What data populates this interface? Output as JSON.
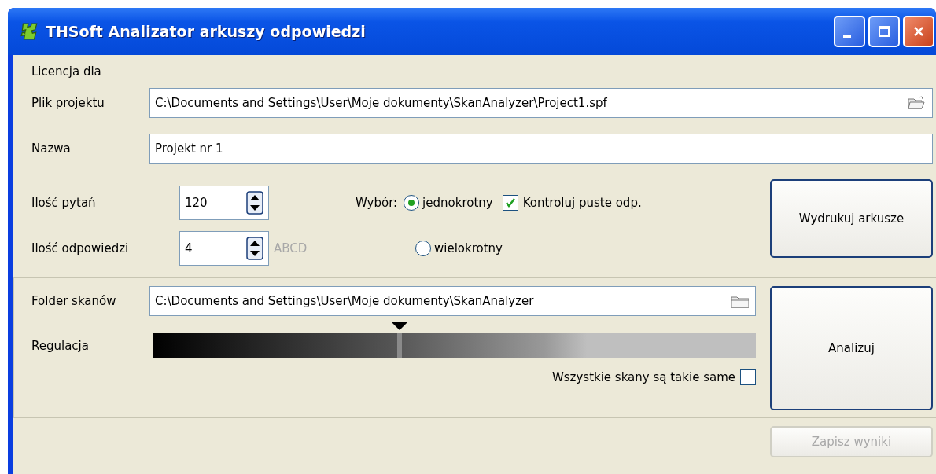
{
  "window": {
    "title": "THSoft Analizator arkuszy odpowiedzi"
  },
  "license": {
    "label": "Licencja dla"
  },
  "project_file": {
    "label": "Plik projektu",
    "value": "C:\\Documents and Settings\\User\\Moje dokumenty\\SkanAnalyzer\\Project1.spf"
  },
  "name": {
    "label": "Nazwa",
    "value": "Projekt nr 1"
  },
  "questions": {
    "label": "Ilość pytań",
    "value": "120"
  },
  "answers": {
    "label": "Ilość odpowiedzi",
    "value": "4",
    "letters": "ABCD"
  },
  "choice": {
    "label": "Wybór:",
    "options": [
      {
        "label": "jednokrotny",
        "selected": true
      },
      {
        "label": "wielokrotny",
        "selected": false
      }
    ]
  },
  "check_empty": {
    "label": "Kontroluj puste odp.",
    "checked": true
  },
  "print_button": "Wydrukuj arkusze",
  "scan_folder": {
    "label": "Folder skanów",
    "value": "C:\\Documents and Settings\\User\\Moje dokumenty\\SkanAnalyzer"
  },
  "regulation": {
    "label": "Regulacja",
    "level": 0.41
  },
  "same_scans": {
    "label": "Wszystkie skany są takie same",
    "checked": false
  },
  "analyze_button": "Analizuj",
  "save_button": {
    "label": "Zapisz wyniki",
    "disabled": true
  }
}
